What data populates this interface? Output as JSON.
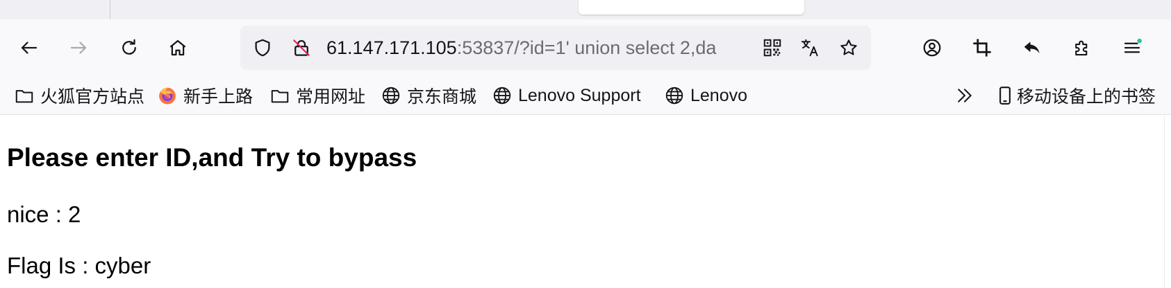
{
  "urlbar": {
    "host": "61.147.171.105",
    "rest": ":53837/?id=1' union select 2,da"
  },
  "bookmarks": [
    {
      "label": "火狐官方站点",
      "icon": "folder-icon"
    },
    {
      "label": "新手上路",
      "icon": "firefox-icon"
    },
    {
      "label": "常用网址",
      "icon": "folder-icon"
    },
    {
      "label": "京东商城",
      "icon": "globe-icon"
    },
    {
      "label": "Lenovo Support",
      "icon": "globe-icon"
    },
    {
      "label": "Lenovo",
      "icon": "globe-icon"
    }
  ],
  "mobile_bookmarks": {
    "label": "移动设备上的书签",
    "icon": "mobile-icon"
  },
  "page": {
    "heading": "Please enter ID,and Try to bypass",
    "line1": "nice : 2",
    "line2": "Flag Is : cyber"
  },
  "colors": {
    "accent_dot": "#2ac3a2",
    "tab_strip": "#f0f0f4",
    "toolbar": "#f9f9fb",
    "urlbar": "#f0f0f4"
  }
}
